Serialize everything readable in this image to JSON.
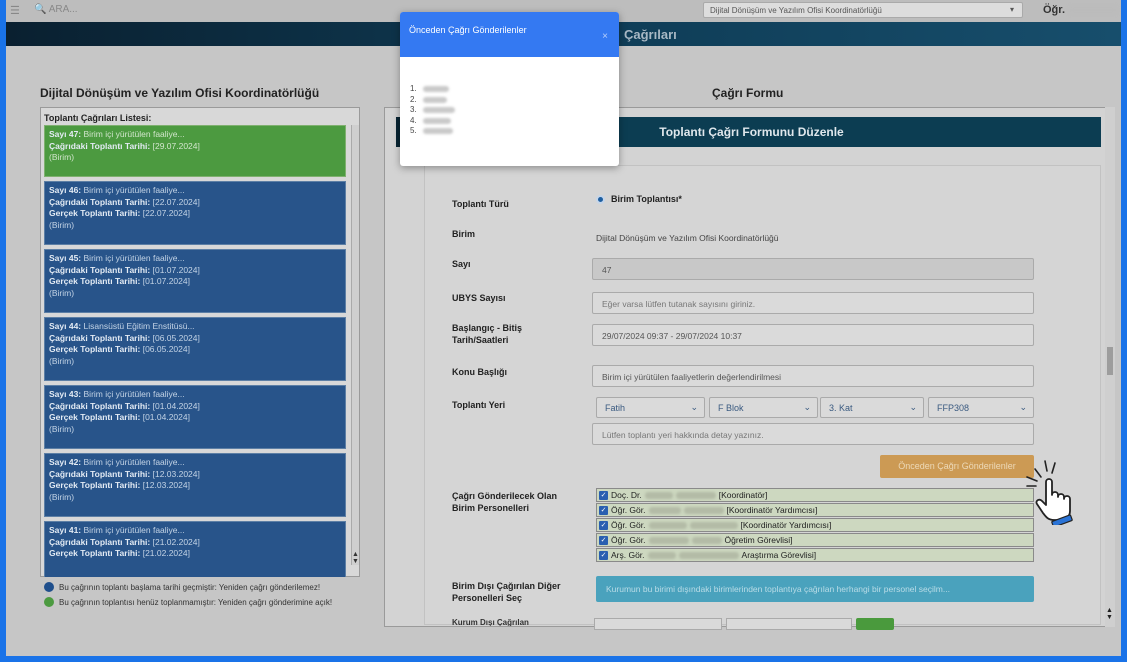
{
  "topbar": {
    "search_placeholder": "ARA...",
    "unit_select_value": "Dijital Dönüşüm ve Yazılım Ofisi Koordinatörlüğü",
    "user_label": "Öğr."
  },
  "banner": {
    "title": "Çağrıları"
  },
  "left": {
    "title": "Dijital Dönüşüm ve Yazılım Ofisi Koordinatörlüğü",
    "list_header": "Toplantı Çağrıları Listesi:",
    "items": [
      {
        "color": "green",
        "say_label": "Sayı 47:",
        "say_text": "Birim içi yürütülen faaliye...",
        "cagri_label": "Çağrıdaki Toplantı Tarihi:",
        "cagri_date": "[29.07.2024]",
        "gercek_label": "",
        "gercek_date": "",
        "type": "(Birim)"
      },
      {
        "color": "blue",
        "say_label": "Sayı 46:",
        "say_text": "Birim içi yürütülen faaliye...",
        "cagri_label": "Çağrıdaki Toplantı Tarihi:",
        "cagri_date": "[22.07.2024]",
        "gercek_label": "Gerçek Toplantı Tarihi:",
        "gercek_date": "[22.07.2024]",
        "type": "(Birim)"
      },
      {
        "color": "blue",
        "say_label": "Sayı 45:",
        "say_text": "Birim içi yürütülen faaliye...",
        "cagri_label": "Çağrıdaki Toplantı Tarihi:",
        "cagri_date": "[01.07.2024]",
        "gercek_label": "Gerçek Toplantı Tarihi:",
        "gercek_date": "[01.07.2024]",
        "type": "(Birim)"
      },
      {
        "color": "blue",
        "say_label": "Sayı 44:",
        "say_text": "Lisansüstü Eğitim Enstitüsü...",
        "cagri_label": "Çağrıdaki Toplantı Tarihi:",
        "cagri_date": "[06.05.2024]",
        "gercek_label": "Gerçek Toplantı Tarihi:",
        "gercek_date": "[06.05.2024]",
        "type": "(Birim)"
      },
      {
        "color": "blue",
        "say_label": "Sayı 43:",
        "say_text": "Birim içi yürütülen faaliye...",
        "cagri_label": "Çağrıdaki Toplantı Tarihi:",
        "cagri_date": "[01.04.2024]",
        "gercek_label": "Gerçek Toplantı Tarihi:",
        "gercek_date": "[01.04.2024]",
        "type": "(Birim)"
      },
      {
        "color": "blue",
        "say_label": "Sayı 42:",
        "say_text": "Birim içi yürütülen faaliye...",
        "cagri_label": "Çağrıdaki Toplantı Tarihi:",
        "cagri_date": "[12.03.2024]",
        "gercek_label": "Gerçek Toplantı Tarihi:",
        "gercek_date": "[12.03.2024]",
        "type": "(Birim)"
      },
      {
        "color": "blue",
        "say_label": "Sayı 41:",
        "say_text": "Birim içi yürütülen faaliye...",
        "cagri_label": "Çağrıdaki Toplantı Tarihi:",
        "cagri_date": "[21.02.2024]",
        "gercek_label": "Gerçek Toplantı Tarihi:",
        "gercek_date": "[21.02.2024]",
        "type": ""
      }
    ],
    "legend": [
      {
        "color": "#1f4f8c",
        "text": "Bu çağrının toplantı başlama tarihi geçmiştir: Yeniden çağrı gönderilemez!"
      },
      {
        "color": "#4c9a40",
        "text": "Bu çağrının toplantısı henüz toplanmamıştır: Yeniden çağrı gönderimine açık!"
      }
    ]
  },
  "form": {
    "title": "Çağrı Formu",
    "header": "Toplantı Çağrı Formunu Düzenle",
    "labels": {
      "toplanti_turu": "Toplantı Türü",
      "birim": "Birim",
      "sayi": "Sayı",
      "ubys": "UBYS Sayısı",
      "tarih_line1": "Başlangıç - Bitiş",
      "tarih_line2": "Tarih/Saatleri",
      "konu": "Konu Başlığı",
      "yer": "Toplantı Yeri",
      "personel_line1": "Çağrı Gönderilecek Olan",
      "personel_line2": "Birim Personelleri",
      "diger_line1": "Birim Dışı Çağırılan Diğer",
      "diger_line2": "Personelleri Seç",
      "cutoff": "Kurum Dışı Çağrılan"
    },
    "radio_label": "Birim Toplantısı*",
    "birim_value": "Dijital Dönüşüm ve Yazılım Ofisi Koordinatörlüğü",
    "sayi_value": "47",
    "ubys_placeholder": "Eğer varsa lütfen tutanak sayısını giriniz.",
    "tarih_value": "29/07/2024 09:37  - 29/07/2024 10:37",
    "konu_value": "Birim içi yürütülen faaliyetlerin değerlendirilmesi",
    "yer_selects": [
      "Fatih",
      "F Blok",
      "3. Kat",
      "FFP308"
    ],
    "yer_detail_placeholder": "Lütfen toplantı yeri hakkında detay yazınız.",
    "onceki_button": "Önceden Çağrı Gönderilenler",
    "staff": [
      {
        "prefix": "Doç. Dr.",
        "role": "[Koordinatör]"
      },
      {
        "prefix": "Öğr. Gör.",
        "role": "[Koordinatör Yardımcısı]"
      },
      {
        "prefix": "Öğr. Gör.",
        "role": "[Koordinatör Yardımcısı]"
      },
      {
        "prefix": "Öğr. Gör.",
        "role": "Öğretim Görevlisi]"
      },
      {
        "prefix": "Arş. Gör.",
        "role": "Araştırma Görevlisi]"
      }
    ],
    "select_external_button": "Kurumun bu birimi dışındaki birimlerinden toplantıya çağrılan herhangi bir personel seçilm..."
  },
  "modal": {
    "title": "Önceden Çağrı Gönderilenler",
    "close": "×",
    "numbers": [
      "1.",
      "2.",
      "3.",
      "4.",
      "5."
    ]
  }
}
